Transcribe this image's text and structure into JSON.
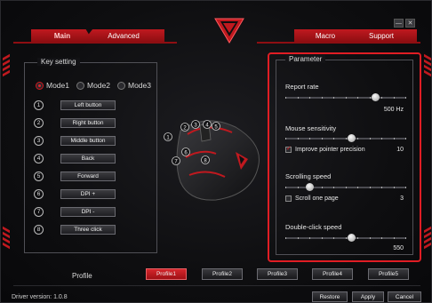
{
  "tabs": {
    "main": "Main",
    "advanced": "Advanced",
    "macro": "Macro",
    "support": "Support"
  },
  "window": {
    "minimize": "—",
    "close": "✕"
  },
  "icons": {
    "logo": "v-logo-icon",
    "minimize": "minimize-icon",
    "close": "close-icon",
    "mouse": "mouse-illustration"
  },
  "colors": {
    "accent": "#c0191f",
    "highlight": "#e01d24"
  },
  "key_setting": {
    "title": "Key setting",
    "modes": [
      {
        "label": "Mode1",
        "selected": true
      },
      {
        "label": "Mode2",
        "selected": false
      },
      {
        "label": "Mode3",
        "selected": false
      }
    ],
    "keys": [
      {
        "num": "1",
        "label": "Left button"
      },
      {
        "num": "2",
        "label": "Right button"
      },
      {
        "num": "3",
        "label": "Middle button"
      },
      {
        "num": "4",
        "label": "Back"
      },
      {
        "num": "5",
        "label": "Forward"
      },
      {
        "num": "6",
        "label": "DPI +"
      },
      {
        "num": "7",
        "label": "DPI -"
      },
      {
        "num": "8",
        "label": "Three click"
      }
    ]
  },
  "mouse_markers": [
    "1",
    "2",
    "3",
    "4",
    "5",
    "6",
    "7",
    "8"
  ],
  "parameter": {
    "title": "Parameter",
    "report_rate": {
      "label": "Report rate",
      "value": "500 Hz",
      "level": 0.75
    },
    "sensitivity": {
      "label": "Mouse sensitivity",
      "value": "10",
      "level": 0.55,
      "option": {
        "label": "Improve pointer precision",
        "checked": true
      }
    },
    "scrolling": {
      "label": "Scrolling speed",
      "value": "3",
      "level": 0.2,
      "option": {
        "label": "Scroll one page",
        "checked": false
      }
    },
    "double_click": {
      "label": "Double-click speed",
      "value": "550",
      "level": 0.55
    }
  },
  "profile": {
    "label": "Profile",
    "items": [
      "Profile1",
      "Profile2",
      "Profile3",
      "Profile4",
      "Profile5"
    ],
    "active_index": 0
  },
  "footer": {
    "driver_version": "Driver version: 1.0.8",
    "restore": "Restore",
    "apply": "Apply",
    "cancel": "Cancel"
  }
}
